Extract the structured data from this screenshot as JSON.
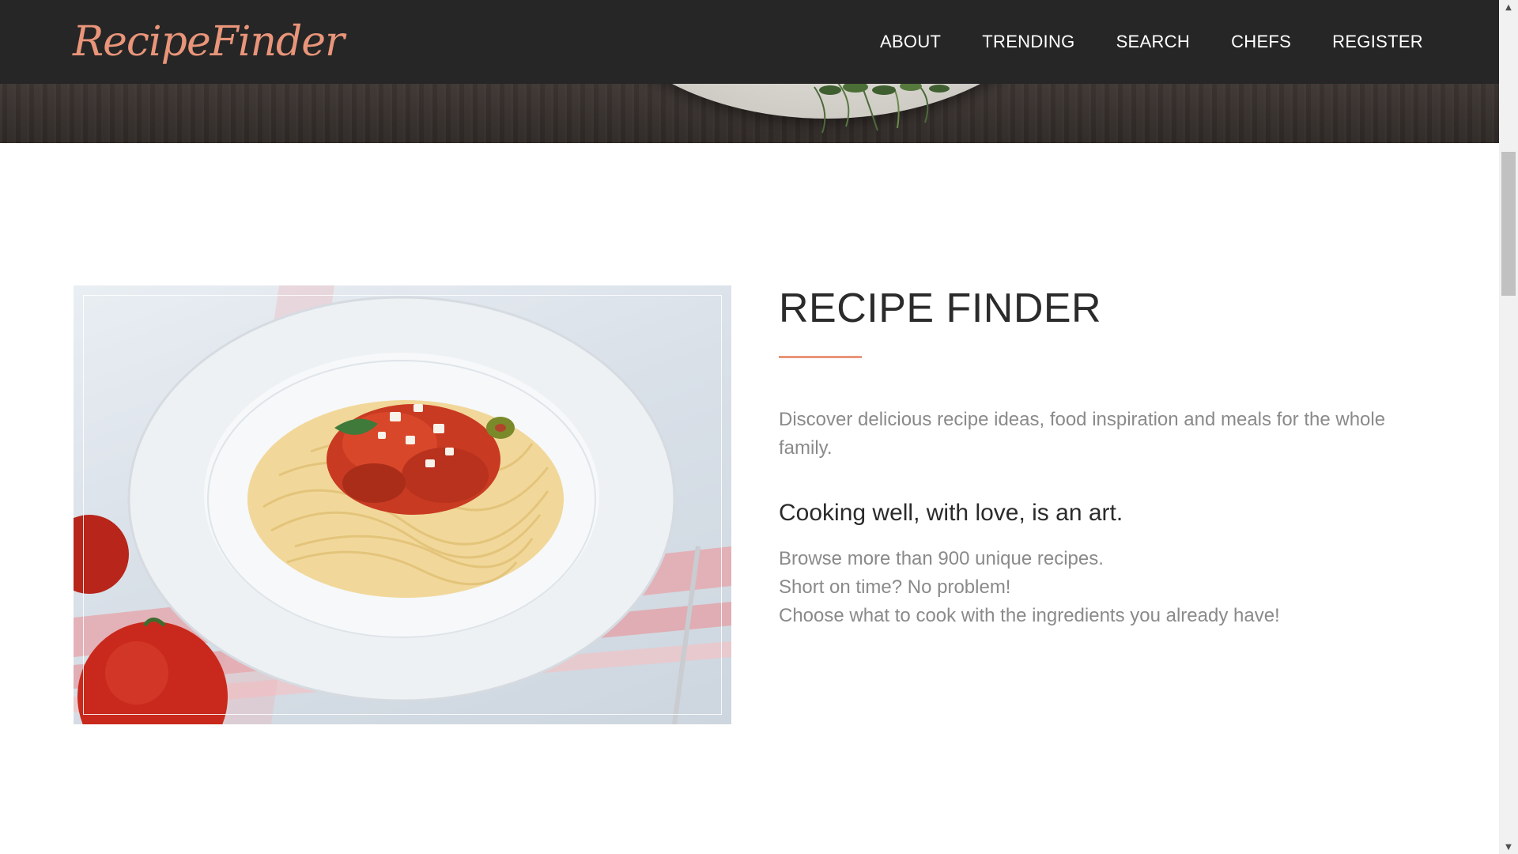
{
  "navbar": {
    "brand": "RecipeFinder",
    "links": [
      {
        "label": "ABOUT"
      },
      {
        "label": "TRENDING"
      },
      {
        "label": "SEARCH"
      },
      {
        "label": "CHEFS"
      },
      {
        "label": "REGISTER"
      }
    ]
  },
  "hero": {
    "image_subject": "salad-plate-on-wooden-table"
  },
  "about": {
    "image_subject": "spaghetti-with-tomato-sauce",
    "title": "RECIPE FINDER",
    "intro": "Discover delicious recipe ideas, food inspiration and meals for the whole family.",
    "subheading": "Cooking well, with love, is an art.",
    "lines": [
      "Browse more than 900 unique recipes.",
      "Short on time? No problem!",
      "Choose what to cook with the ingredients you already have!"
    ]
  },
  "colors": {
    "navbar_bg": "#262626",
    "accent": "#e9957a",
    "heading": "#2b2b2b",
    "body_text": "#8a8a8a"
  },
  "icons": {
    "scroll_up": "scroll-up-arrow-icon",
    "scroll_down": "scroll-down-arrow-icon"
  }
}
